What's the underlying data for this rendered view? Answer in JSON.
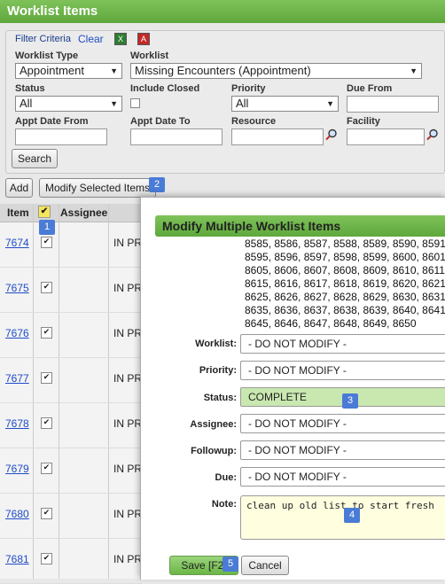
{
  "page": {
    "title": "Worklist Items"
  },
  "filter": {
    "title": "Filter Criteria",
    "clear": "Clear",
    "worklist_type": {
      "label": "Worklist Type",
      "value": "Appointment"
    },
    "worklist": {
      "label": "Worklist",
      "value": "Missing Encounters (Appointment)"
    },
    "status": {
      "label": "Status",
      "value": "All"
    },
    "include_closed": {
      "label": "Include Closed",
      "checked": false
    },
    "priority": {
      "label": "Priority",
      "value": "All"
    },
    "due_from": {
      "label": "Due From",
      "value": ""
    },
    "appt_date_from": {
      "label": "Appt Date From",
      "value": ""
    },
    "appt_date_to": {
      "label": "Appt Date To",
      "value": ""
    },
    "resource": {
      "label": "Resource",
      "value": ""
    },
    "facility": {
      "label": "Facility",
      "value": ""
    },
    "search": "Search"
  },
  "toolbar": {
    "add": "Add",
    "modify": "Modify Selected Items"
  },
  "grid": {
    "headers": {
      "item": "Item",
      "assignee": "Assignee"
    },
    "rows": [
      {
        "item": "7674",
        "status": "IN PR"
      },
      {
        "item": "7675",
        "status": "IN PR"
      },
      {
        "item": "7676",
        "status": "IN PR"
      },
      {
        "item": "7677",
        "status": "IN PR"
      },
      {
        "item": "7678",
        "status": "IN PR"
      },
      {
        "item": "7679",
        "status": "IN PR"
      },
      {
        "item": "7680",
        "status": "IN PR"
      },
      {
        "item": "7681",
        "status": "IN PR"
      }
    ]
  },
  "modal": {
    "title": "Modify Multiple Worklist Items",
    "item_lines": [
      "8585, 8586, 8587, 8588, 8589, 8590, 8591",
      "8595, 8596, 8597, 8598, 8599, 8600, 8601",
      "8605, 8606, 8607, 8608, 8609, 8610, 8611",
      "8615, 8616, 8617, 8618, 8619, 8620, 8621",
      "8625, 8626, 8627, 8628, 8629, 8630, 8631",
      "8635, 8636, 8637, 8638, 8639, 8640, 8641",
      "8645, 8646, 8647, 8648, 8649, 8650"
    ],
    "fields": {
      "worklist": {
        "label": "Worklist:",
        "value": "- DO NOT MODIFY -"
      },
      "priority": {
        "label": "Priority:",
        "value": "- DO NOT MODIFY -"
      },
      "status": {
        "label": "Status:",
        "value": "COMPLETE"
      },
      "assignee": {
        "label": "Assignee:",
        "value": "- DO NOT MODIFY -"
      },
      "followup": {
        "label": "Followup:",
        "value": "- DO NOT MODIFY -"
      },
      "due": {
        "label": "Due:",
        "value": "- DO NOT MODIFY -"
      },
      "note": {
        "label": "Note:",
        "value": "clean up old list to start fresh"
      }
    },
    "save": "Save [F2]",
    "cancel": "Cancel"
  },
  "badges": [
    "1",
    "2",
    "3",
    "4",
    "5"
  ],
  "colors": {
    "header_green": "#5ea83c",
    "badge_blue": "#4a7bd6",
    "status_green": "#c9e8b0",
    "note_yellow": "#ffffe0"
  }
}
